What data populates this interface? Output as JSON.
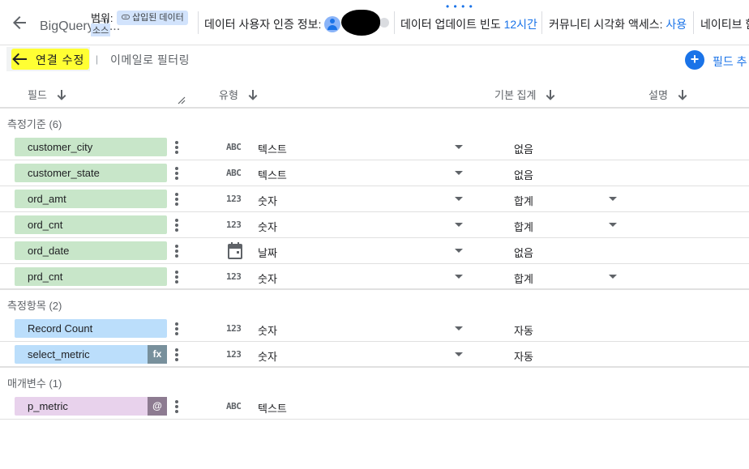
{
  "header": {
    "source_name": "BigQuery 데...",
    "scope_label": "범위:",
    "scope_chip": "삽입된 데이터",
    "scope_sub": "소스",
    "credentials_label": "데이터 사용자 인증 정보:",
    "freshness_label": "데이터 업데이트 빈도",
    "freshness_value": "12시간",
    "community_label": "커뮤니티 시각화 액세스:",
    "community_value": "사용",
    "native_label": "네이티브 함"
  },
  "toolbar": {
    "edit_connection": "연결 수정",
    "separator": "|",
    "email_filter": "이메일로 필터링",
    "add_field": "필드 추"
  },
  "columns": {
    "field": "필드",
    "type": "유형",
    "default_agg": "기본 집계",
    "description": "설명"
  },
  "sections": {
    "dimensions": "측정기준 (6)",
    "metrics": "측정항목 (2)",
    "parameters": "매개변수 (1)"
  },
  "dimensions": [
    {
      "name": "customer_city",
      "type_icon": "ABC",
      "type": "텍스트",
      "agg": "없음"
    },
    {
      "name": "customer_state",
      "type_icon": "ABC",
      "type": "텍스트",
      "agg": "없음"
    },
    {
      "name": "ord_amt",
      "type_icon": "123",
      "type": "숫자",
      "agg": "합계"
    },
    {
      "name": "ord_cnt",
      "type_icon": "123",
      "type": "숫자",
      "agg": "합계"
    },
    {
      "name": "ord_date",
      "type_icon": "calendar-icon",
      "type": "날짜",
      "agg": "없음"
    },
    {
      "name": "prd_cnt",
      "type_icon": "123",
      "type": "숫자",
      "agg": "합계"
    }
  ],
  "metrics": [
    {
      "name": "Record Count",
      "type_icon": "123",
      "type": "숫자",
      "agg": "자동"
    },
    {
      "name": "select_metric",
      "badge": "fx",
      "type_icon": "123",
      "type": "숫자",
      "agg": "자동"
    }
  ],
  "parameters": [
    {
      "name": "p_metric",
      "badge": "@",
      "type_icon": "ABC",
      "type": "텍스트"
    }
  ],
  "colors": {
    "accent": "#1a73e8",
    "dimension_chip": "#c8e6c9",
    "metric_chip": "#bbdefb",
    "parameter_chip": "#e8d2ec",
    "highlight": "#ffff33"
  }
}
